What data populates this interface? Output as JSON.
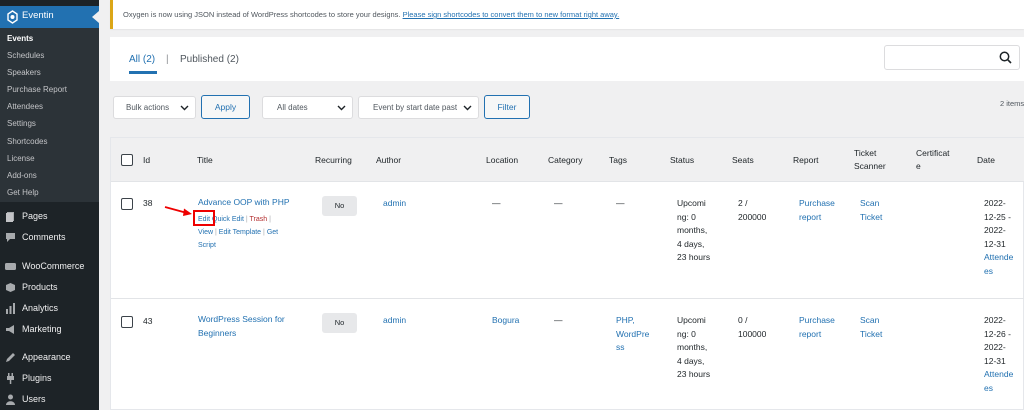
{
  "sidebar": {
    "plugin_title": "Eventin",
    "submenu": [
      "Events",
      "Schedules",
      "Speakers",
      "Purchase Report",
      "Attendees",
      "Settings",
      "Shortcodes",
      "License",
      "Add-ons",
      "Get Help"
    ],
    "menu": [
      {
        "label": "Pages",
        "icon": "pages-icon"
      },
      {
        "label": "Comments",
        "icon": "comments-icon"
      },
      {
        "label": "WooCommerce",
        "icon": "woocommerce-icon"
      },
      {
        "label": "Products",
        "icon": "products-icon"
      },
      {
        "label": "Analytics",
        "icon": "analytics-icon"
      },
      {
        "label": "Marketing",
        "icon": "marketing-icon"
      },
      {
        "label": "Appearance",
        "icon": "appearance-icon"
      },
      {
        "label": "Plugins",
        "icon": "plugins-icon"
      },
      {
        "label": "Users",
        "icon": "users-icon"
      }
    ]
  },
  "notice": {
    "text": "Oxygen is now using JSON instead of WordPress shortcodes to store your designs. ",
    "link": "Please sign shortcodes to convert them to new format right away."
  },
  "tabs": {
    "all": "All (2)",
    "separator": "|",
    "published": "Published (2)"
  },
  "filters": {
    "bulk_actions": "Bulk actions",
    "apply": "Apply",
    "dates": "All dates",
    "sort": "Event by start date past",
    "filter": "Filter",
    "items_count": "2 items"
  },
  "table": {
    "headers": {
      "id": "Id",
      "title": "Title",
      "recurring": "Recurring",
      "author": "Author",
      "location": "Location",
      "category": "Category",
      "tags": "Tags",
      "status": "Status",
      "seats": "Seats",
      "report": "Report",
      "scanner_1": "Ticket",
      "scanner_2": "Scanner",
      "certificate_1": "Certificat",
      "certificate_2": "e",
      "date": "Date"
    },
    "rows": [
      {
        "id": "38",
        "title": "Advance OOP with PHP",
        "title_2": "",
        "recurring": "No",
        "author": "admin",
        "location": "—",
        "category": "—",
        "tags_1": "—",
        "tags_2": "",
        "tags_3": "",
        "status_1": "Upcomi",
        "status_2": "ng: 0",
        "status_3": "months,",
        "status_4": "4 days,",
        "status_5": "23 hours",
        "seats_1": "2 /",
        "seats_2": "200000",
        "report_1": "Purchase",
        "report_2": "report",
        "scanner_1": "Scan",
        "scanner_2": "Ticket",
        "date_1": "2022-",
        "date_2": "12-25 -",
        "date_3": "2022-",
        "date_4": "12-31",
        "date_5": "Attende",
        "date_6": "es",
        "actions": {
          "edit": "Edit",
          "quick_edit": "Quick Edit",
          "trash": "Trash",
          "view": "View",
          "edit_template": "Edit Template",
          "get": "Get",
          "script": "Script"
        }
      },
      {
        "id": "43",
        "title": "WordPress Session for",
        "title_2": "Beginners",
        "recurring": "No",
        "author": "admin",
        "location": "Bogura",
        "category": "—",
        "tags_1": "PHP,",
        "tags_2": "WordPre",
        "tags_3": "ss",
        "status_1": "Upcomi",
        "status_2": "ng: 0",
        "status_3": "months,",
        "status_4": "4 days,",
        "status_5": "23 hours",
        "seats_1": "0 /",
        "seats_2": "100000",
        "report_1": "Purchase",
        "report_2": "report",
        "scanner_1": "Scan",
        "scanner_2": "Ticket",
        "date_1": "2022-",
        "date_2": "12-26 -",
        "date_3": "2022-",
        "date_4": "12-31",
        "date_5": "Attende",
        "date_6": "es"
      }
    ]
  },
  "colors": {
    "accent": "#2271b1",
    "sidebar": "#1d2327",
    "highlight": "#e00000"
  }
}
